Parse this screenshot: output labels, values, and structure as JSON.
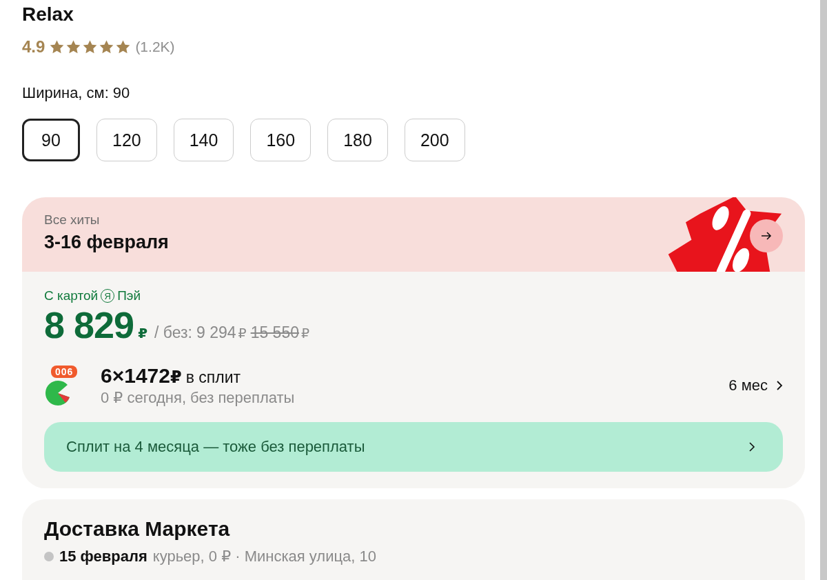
{
  "title_tail": "Relax",
  "rating": {
    "score": "4.9",
    "stars": 5,
    "count": "(1.2K)"
  },
  "width_selector": {
    "label": "Ширина, см:",
    "value": "90",
    "options": [
      {
        "label": "90",
        "selected": true
      },
      {
        "label": "120",
        "selected": false
      },
      {
        "label": "140",
        "selected": false
      },
      {
        "label": "160",
        "selected": false
      },
      {
        "label": "180",
        "selected": false
      },
      {
        "label": "200",
        "selected": false
      }
    ]
  },
  "promo": {
    "caption": "Все хиты",
    "dates": "3-16 февраля"
  },
  "price": {
    "card_prefix": "С картой",
    "brand_mark": "Я",
    "brand_name": "Пэй",
    "amount": "8 829",
    "currency": "₽",
    "without_label": "/ без:",
    "without_amount": "9 294",
    "without_currency": "₽",
    "old_amount": "15 550",
    "old_currency": "₽"
  },
  "split": {
    "badge": "006",
    "amount": "6×1472",
    "currency": "₽",
    "suffix": "в сплит",
    "subtitle": "0 ₽ сегодня, без переплаты",
    "period": "6 мес",
    "banner": "Сплит на 4 месяца — тоже без переплаты"
  },
  "delivery": {
    "title": "Доставка Маркета",
    "date": "15 февраля",
    "details": "курьер, 0 ₽ · Минская улица, 10"
  }
}
